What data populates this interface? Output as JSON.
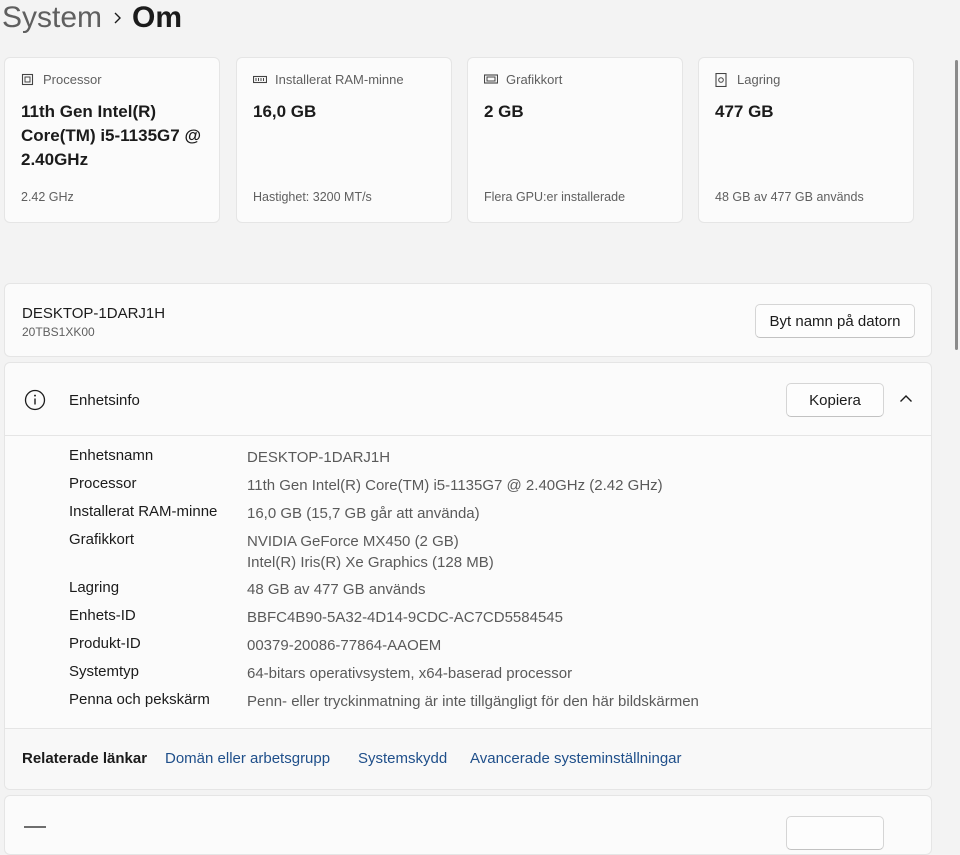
{
  "breadcrumb": {
    "parent": "System",
    "current": "Om"
  },
  "specs": [
    {
      "label": "Processor",
      "value": "11th Gen Intel(R) Core(TM) i5-1135G7 @ 2.40GHz",
      "sub": "2.42 GHz",
      "icon": "processor-icon"
    },
    {
      "label": "Installerat RAM-minne",
      "value": "16,0 GB",
      "sub": "Hastighet: 3200 MT/s",
      "icon": "ram-icon"
    },
    {
      "label": "Grafikkort",
      "value": "2 GB",
      "sub": "Flera GPU:er installerade",
      "icon": "gpu-icon"
    },
    {
      "label": "Lagring",
      "value": "477 GB",
      "sub": "48 GB av 477 GB används",
      "icon": "storage-icon"
    }
  ],
  "device": {
    "name": "DESKTOP-1DARJ1H",
    "model": "20TBS1XK00",
    "rename_label": "Byt namn på datorn"
  },
  "device_info": {
    "title": "Enhetsinfo",
    "copy_label": "Kopiera",
    "rows": [
      {
        "label": "Enhetsnamn",
        "value": "DESKTOP-1DARJ1H"
      },
      {
        "label": "Processor",
        "value": "11th Gen Intel(R) Core(TM) i5-1135G7 @ 2.40GHz (2.42 GHz)"
      },
      {
        "label": "Installerat RAM-minne",
        "value": "16,0 GB (15,7 GB går att använda)"
      },
      {
        "label": "Grafikkort",
        "value": "NVIDIA GeForce MX450 (2 GB)",
        "value2": "Intel(R) Iris(R) Xe Graphics (128 MB)"
      },
      {
        "label": "Lagring",
        "value": "48 GB av 477 GB används"
      },
      {
        "label": "Enhets-ID",
        "value": "BBFC4B90-5A32-4D14-9CDC-AC7CD5584545"
      },
      {
        "label": "Produkt-ID",
        "value": "00379-20086-77864-AAOEM"
      },
      {
        "label": "Systemtyp",
        "value": "64-bitars operativsystem, x64-baserad processor"
      },
      {
        "label": "Penna och pekskärm",
        "value": "Penn- eller tryckinmatning är inte tillgängligt för den här bildskärmen"
      }
    ]
  },
  "related_links": {
    "label": "Relaterade länkar",
    "links": [
      "Domän eller arbetsgrupp",
      "Systemskydd",
      "Avancerade systeminställningar"
    ]
  },
  "colors": {
    "link": "#1f4f8a",
    "card_bg": "#fbfbfb",
    "page_bg": "#f3f3f3"
  }
}
